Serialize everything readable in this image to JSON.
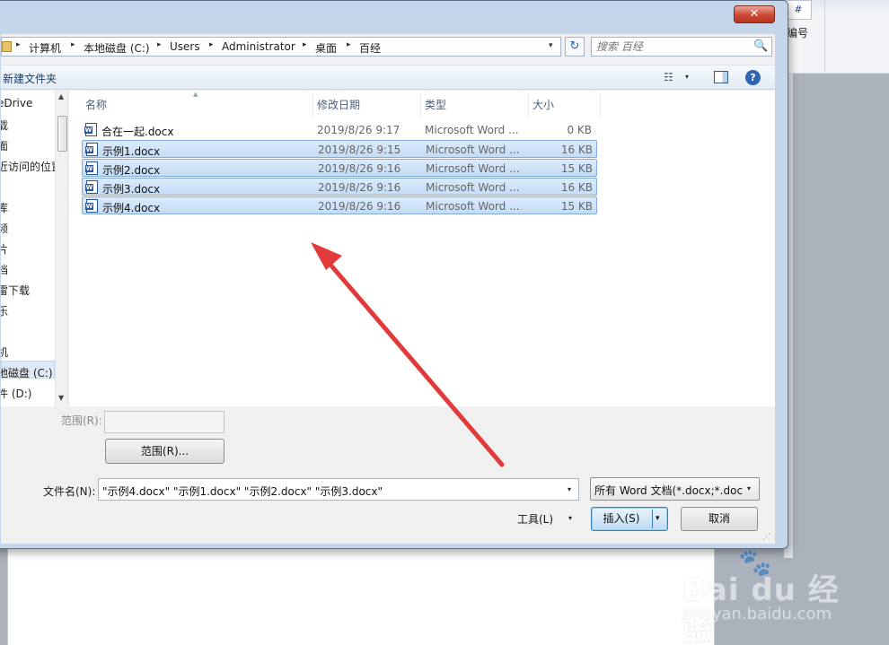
{
  "background_app": {
    "number_button_icon": "#",
    "number_label": "编号"
  },
  "window": {
    "close_label": "✕"
  },
  "address": {
    "crumbs": [
      "计算机",
      "本地磁盘 (C:)",
      "Users",
      "Administrator",
      "桌面",
      "百经"
    ],
    "separator": "▸",
    "dropdown": "▾",
    "refresh_icon": "↻"
  },
  "search": {
    "placeholder": "搜索 百经",
    "icon": "🔍"
  },
  "toolbar": {
    "new_folder_label": "新建文件夹",
    "view_icon": "☷",
    "view_dropdown": "▾",
    "help_label": "?"
  },
  "nav": {
    "items": [
      {
        "label": "eDrive"
      },
      {
        "label": "载"
      },
      {
        "label": "面"
      },
      {
        "label": "近访问的位置"
      },
      {
        "label": ""
      },
      {
        "label": "库"
      },
      {
        "label": "频"
      },
      {
        "label": "片"
      },
      {
        "label": "档"
      },
      {
        "label": "雷下载"
      },
      {
        "label": "乐"
      },
      {
        "label": ""
      },
      {
        "label": "机"
      },
      {
        "label": "地磁盘 (C:)"
      },
      {
        "label": "件 (D:)"
      }
    ],
    "scroll_up": "▲",
    "scroll_down": "▼"
  },
  "file_list": {
    "columns": [
      "名称",
      "修改日期",
      "类型",
      "大小"
    ],
    "sort_indicator": "▲",
    "icon_letter": "W",
    "rows": [
      {
        "name": "合在一起.docx",
        "date": "2019/8/26 9:17",
        "type": "Microsoft Word ...",
        "size": "0 KB",
        "selected": false
      },
      {
        "name": "示例1.docx",
        "date": "2019/8/26 9:15",
        "type": "Microsoft Word ...",
        "size": "16 KB",
        "selected": true
      },
      {
        "name": "示例2.docx",
        "date": "2019/8/26 9:16",
        "type": "Microsoft Word ...",
        "size": "15 KB",
        "selected": true
      },
      {
        "name": "示例3.docx",
        "date": "2019/8/26 9:16",
        "type": "Microsoft Word ...",
        "size": "16 KB",
        "selected": true
      },
      {
        "name": "示例4.docx",
        "date": "2019/8/26 9:16",
        "type": "Microsoft Word ...",
        "size": "15 KB",
        "selected": true
      }
    ]
  },
  "bottom": {
    "range_label": "范围(R):",
    "range_value": "",
    "range_button": "范围(R)...",
    "filename_label": "文件名(N):",
    "filename_value": "\"示例4.docx\" \"示例1.docx\" \"示例2.docx\" \"示例3.docx\"",
    "filename_dropdown": "▾",
    "filetype_value": "所有 Word 文档(*.docx;*.docm",
    "filetype_dropdown": "▾",
    "tools_label": "工具(L)",
    "tools_dropdown": "▾",
    "insert_label": "插入(S)",
    "insert_dropdown": "▾",
    "cancel_label": "取消",
    "resize_grip": "⋰"
  },
  "annotation": {
    "arrow_color": "#e23a3a"
  },
  "watermark": {
    "logo_text": "Bai  du 经验",
    "paw": "🐾",
    "url": "jingyan.baidu.com"
  },
  "colors": {
    "selection": "#c4dcf5",
    "selection_border": "#84acdd",
    "close_button": "#c94932",
    "accent": "#2d66b4"
  }
}
